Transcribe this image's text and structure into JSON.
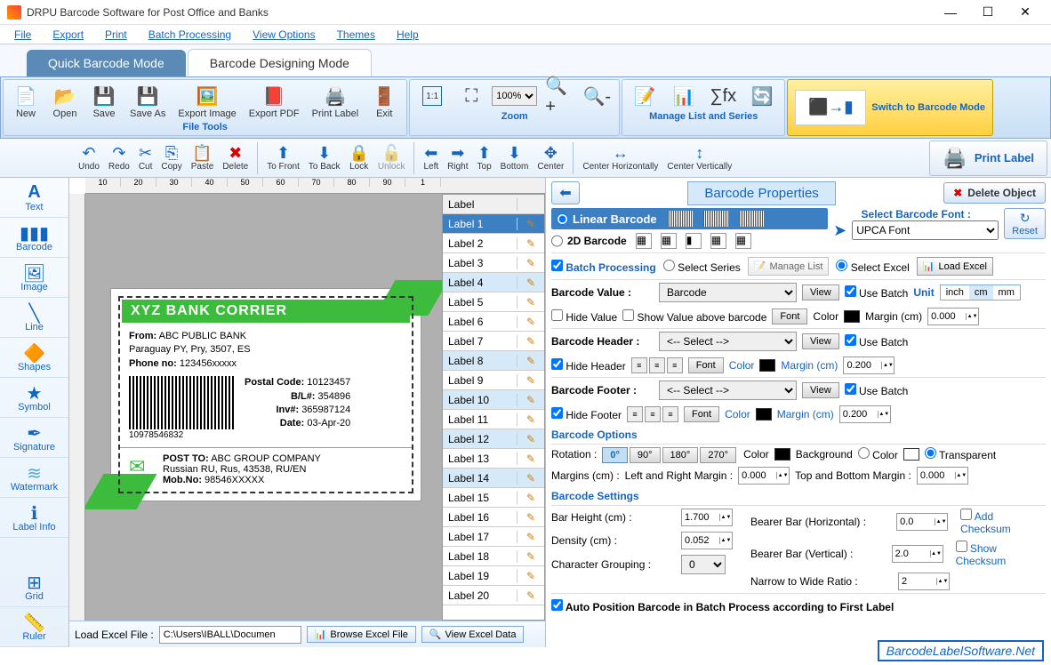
{
  "window": {
    "title": "DRPU Barcode Software for Post Office and Banks"
  },
  "menu": [
    "File",
    "Export",
    "Print",
    "Batch Processing",
    "View Options",
    "Themes",
    "Help"
  ],
  "modeTabs": {
    "quick": "Quick Barcode Mode",
    "design": "Barcode Designing Mode"
  },
  "ribbon": {
    "fileTools": {
      "label": "File Tools",
      "items": [
        "New",
        "Open",
        "Save",
        "Save As",
        "Export Image",
        "Export PDF",
        "Print Label",
        "Exit"
      ]
    },
    "zoom": {
      "label": "Zoom",
      "value": "100%"
    },
    "manage": {
      "label": "Manage List and Series"
    },
    "switch": {
      "label": "Switch to Barcode Mode"
    }
  },
  "toolbar2": [
    "Undo",
    "Redo",
    "Cut",
    "Copy",
    "Paste",
    "Delete",
    "To Front",
    "To Back",
    "Lock",
    "Unlock",
    "Left",
    "Right",
    "Top",
    "Bottom",
    "Center",
    "Center Horizontally",
    "Center Vertically"
  ],
  "printLabelBtn": "Print Label",
  "leftTools": [
    "Text",
    "Barcode",
    "Image",
    "Line",
    "Shapes",
    "Symbol",
    "Signature",
    "Watermark",
    "Label Info",
    "Grid",
    "Ruler"
  ],
  "rulerMarks": [
    "10",
    "20",
    "30",
    "40",
    "50",
    "60",
    "70",
    "80",
    "90",
    "1"
  ],
  "labelPreview": {
    "title": "XYZ BANK CORRIER",
    "fromLabel": "From:",
    "fromName": "ABC PUBLIC BANK",
    "fromAddr": "Paraguay PY, Pry, 3507, ES",
    "phoneLabel": "Phone no:",
    "phone": "123456xxxxx",
    "postalLabel": "Postal Code:",
    "postal": "10123457",
    "blLabel": "B/L#:",
    "bl": "354896",
    "invLabel": "Inv#:",
    "inv": "365987124",
    "dateLabel": "Date:",
    "date": "03-Apr-20",
    "barcodeNum": "10978546832",
    "postToLabel": "POST TO:",
    "postToName": "ABC GROUP COMPANY",
    "postToAddr": "Russian RU, Rus, 43538, RU/EN",
    "mobLabel": "Mob.No:",
    "mob": "98546XXXXX"
  },
  "labelList": {
    "header": "Label",
    "items": [
      "Label 1",
      "Label 2",
      "Label 3",
      "Label 4",
      "Label 5",
      "Label 6",
      "Label 7",
      "Label 8",
      "Label 9",
      "Label 10",
      "Label 11",
      "Label 12",
      "Label 13",
      "Label 14",
      "Label 15",
      "Label 16",
      "Label 17",
      "Label 18",
      "Label 19",
      "Label 20"
    ],
    "selected": 0
  },
  "props": {
    "title": "Barcode Properties",
    "deleteObj": "Delete Object",
    "linear": "Linear Barcode",
    "twoD": "2D Barcode",
    "selectFont": "Select Barcode Font :",
    "fontSel": "UPCA Font",
    "reset": "Reset",
    "batch": "Batch Processing",
    "selectSeries": "Select Series",
    "manageList": "Manage List",
    "selectExcel": "Select Excel",
    "loadExcel": "Load Excel",
    "bcValueLbl": "Barcode Value :",
    "bcValue": "Barcode",
    "view": "View",
    "useBatch": "Use Batch",
    "unitLbl": "Unit",
    "units": [
      "inch",
      "cm",
      "mm"
    ],
    "hideValue": "Hide Value",
    "showAbove": "Show Value above barcode",
    "font": "Font",
    "color": "Color",
    "marginLbl": "Margin (cm)",
    "marginVal": "0.000",
    "bcHeaderLbl": "Barcode Header :",
    "hfSelect": "<-- Select -->",
    "hideHeader": "Hide Header",
    "hfMargin": "0.200",
    "bcFooterLbl": "Barcode Footer :",
    "hideFooter": "Hide Footer",
    "optionsHead": "Barcode Options",
    "rotationLbl": "Rotation :",
    "rotOpts": [
      "0°",
      "90°",
      "180°",
      "270°"
    ],
    "background": "Background",
    "transparent": "Transparent",
    "marginsLbl": "Margins (cm) :",
    "lrMargin": "Left and Right Margin :",
    "tbMargin": "Top and Bottom Margin :",
    "marginZero": "0.000",
    "settingsHead": "Barcode Settings",
    "barHeightLbl": "Bar Height (cm) :",
    "barHeight": "1.700",
    "densityLbl": "Density (cm) :",
    "density": "0.052",
    "charGroupLbl": "Character Grouping :",
    "charGroup": "0",
    "bearerHLbl": "Bearer Bar (Horizontal) :",
    "bearerH": "0.0",
    "bearerVLbl": "Bearer Bar (Vertical) :",
    "bearerV": "2.0",
    "n2wLbl": "Narrow to Wide Ratio :",
    "n2w": "2",
    "addCk": "Add Checksum",
    "showCk": "Show Checksum",
    "autoPos": "Auto Position Barcode in Batch Process according to First Label"
  },
  "footer": {
    "loadLabel": "Load Excel File :",
    "path": "C:\\Users\\IBALL\\Documen",
    "browse": "Browse Excel File",
    "viewData": "View Excel Data",
    "brand": "BarcodeLabelSoftware.Net"
  }
}
